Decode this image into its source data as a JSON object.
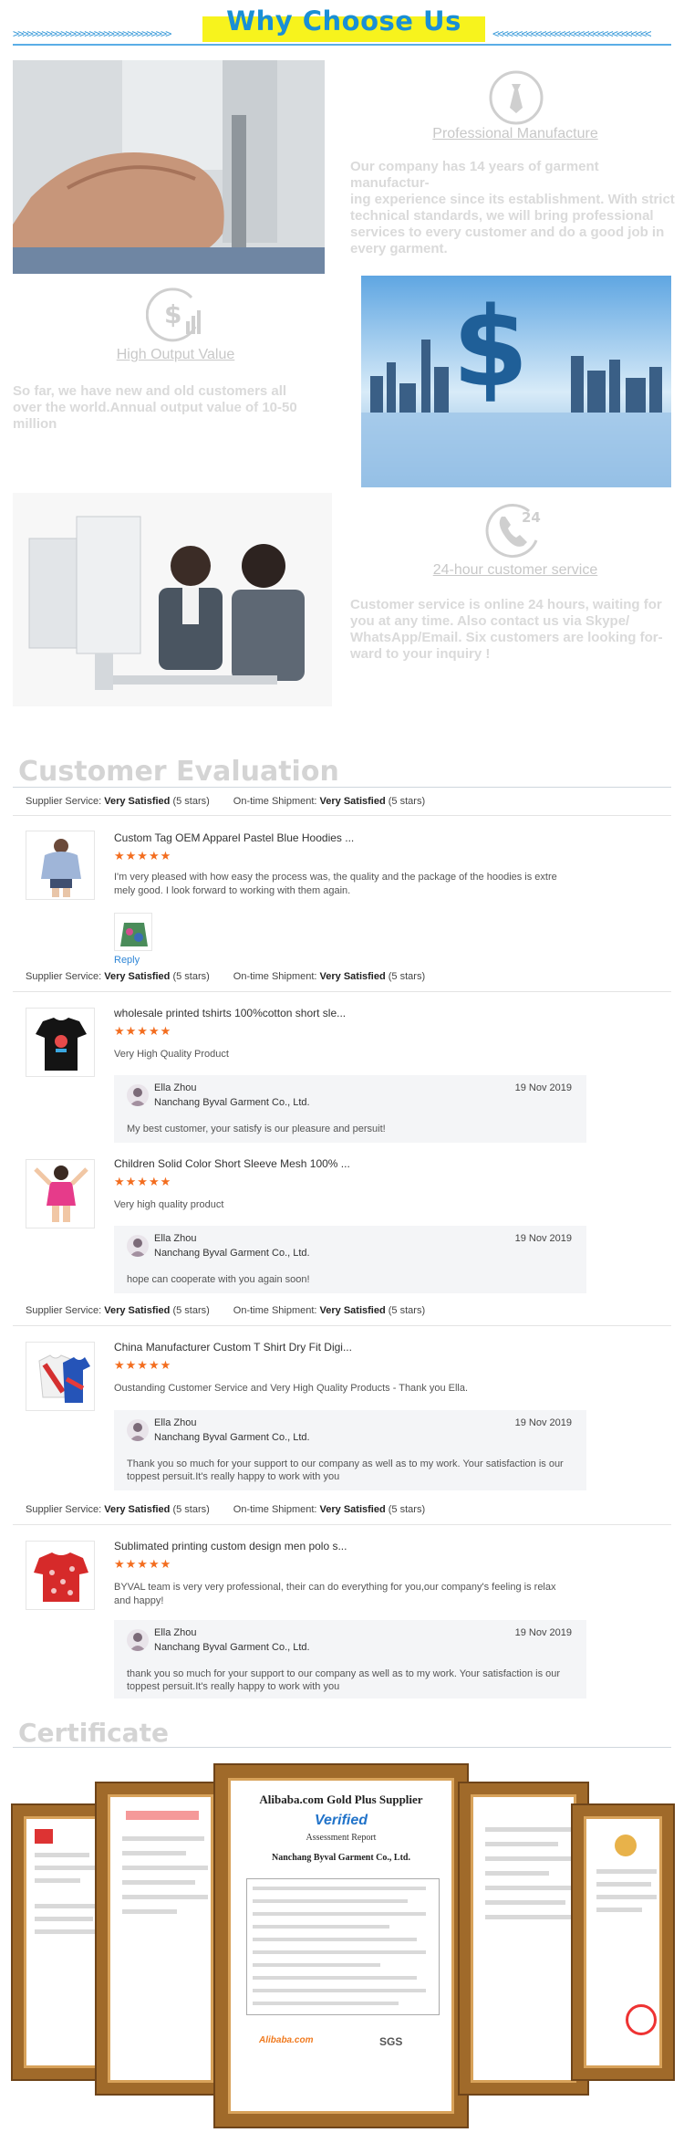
{
  "header": {
    "title": "Why Choose Us",
    "accent": "#f7f31d",
    "title_color": "#1a8fd6"
  },
  "features": [
    {
      "icon": "tie-icon",
      "title": "Professional Manufacture",
      "lines": [
        "Our company has 14 years of garment manufactur-",
        "ing experience since its establishment. With strict",
        "technical standards, we will bring professional",
        "services to every customer and do a good job in",
        "every garment."
      ]
    },
    {
      "icon": "dollar-chart-icon",
      "title": "High Output Value",
      "lines": [
        "So far, we have new and old customers all",
        "over the world.Annual output value of 10-50",
        "million"
      ]
    },
    {
      "icon": "phone-24-icon",
      "title": "24-hour customer service",
      "lines": [
        "Customer service is online 24 hours, waiting for",
        "you at any time. Also contact us via Skype/",
        "WhatsApp/Email. Six customers are looking for-",
        "ward to your inquiry !"
      ]
    }
  ],
  "evaluation": {
    "title": "Customer Evaluation",
    "service_label": "Supplier Service:",
    "shipment_label": "On-time Shipment:",
    "rating_word": "Very Satisfied",
    "rating_stars": "(5 stars)",
    "stars": "★★★★★",
    "reply_label": "Reply",
    "groups": [
      {
        "items": [
          {
            "product": "Custom Tag OEM Apparel Pastel Blue Hoodies ...",
            "review_lines": [
              "I'm very pleased with how easy the process was, the quality and the package of the hoodies is extre",
              "mely good. I look forward to working with them again."
            ]
          }
        ]
      },
      {
        "items": [
          {
            "product": "wholesale printed tshirts 100%cotton short sle...",
            "review_lines": [
              "Very High Quality Product"
            ],
            "reply": {
              "name": "Ella Zhou",
              "company": "Nanchang Byval Garment Co., Ltd.",
              "date": "19 Nov 2019",
              "lines": [
                "My best customer, your satisfy is our pleasure and persuit!"
              ]
            }
          },
          {
            "product": "Children Solid Color Short Sleeve Mesh 100% ...",
            "review_lines": [
              "Very high quality product"
            ],
            "reply": {
              "name": "Ella Zhou",
              "company": "Nanchang Byval Garment Co., Ltd.",
              "date": "19 Nov 2019",
              "lines": [
                "hope can cooperate with you again soon!"
              ]
            }
          }
        ]
      },
      {
        "items": [
          {
            "product": "China Manufacturer Custom T Shirt Dry Fit Digi...",
            "review_lines": [
              "Oustanding Customer Service and Very High Quality Products - Thank you Ella."
            ],
            "reply": {
              "name": "Ella Zhou",
              "company": "Nanchang Byval Garment Co., Ltd.",
              "date": "19 Nov 2019",
              "lines": [
                "Thank you so much for your support to our company as well as to my work. Your satisfaction is our",
                "toppest persuit.It's really happy to work with you"
              ]
            }
          }
        ]
      },
      {
        "items": [
          {
            "product": "Sublimated printing custom design men polo s...",
            "review_lines": [
              "BYVAL team is very very professional, their can do everything for you,our company's feeling is relax",
              " and happy!"
            ],
            "reply": {
              "name": "Ella Zhou",
              "company": "Nanchang Byval Garment Co., Ltd.",
              "date": "19 Nov 2019",
              "lines": [
                " thank you so much for your support to our company as well as to my work. Your satisfaction is our",
                "toppest persuit.It's really happy to work with you"
              ]
            }
          }
        ]
      }
    ]
  },
  "certificate": {
    "title": "Certificate",
    "center": {
      "heading": "Alibaba.com Gold Plus Supplier",
      "verified": "Verified",
      "report": "Assessment Report",
      "company": "Nanchang Byval Garment Co., Ltd.",
      "sgs": "SGS",
      "alibaba": "Alibaba.com"
    }
  }
}
